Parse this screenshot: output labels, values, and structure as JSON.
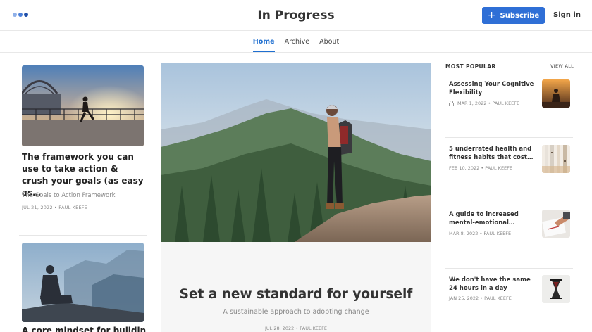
{
  "brand": {
    "accent": "#2f6fd6",
    "logo_dots": [
      "#8fb0e8",
      "#4b7fd8",
      "#1f4fa8"
    ]
  },
  "header": {
    "site_title": "In Progress",
    "subscribe_label": "Subscribe",
    "signin_label": "Sign in"
  },
  "nav": {
    "items": [
      {
        "label": "Home",
        "active": true
      },
      {
        "label": "Archive"
      },
      {
        "label": "About"
      }
    ]
  },
  "left_column": {
    "cards": [
      {
        "title": "The framework you can use to take action & crush your goals (as easy as…",
        "subtitle": "The Goals to Action Framework",
        "meta": "JUL 21, 2022 • PAUL KEEFE",
        "image": "runner-on-bridge-at-sunset"
      },
      {
        "title": "A core mindset for building",
        "image": "man-sitting-on-cliff-in-mist"
      }
    ]
  },
  "featured": {
    "title": "Set a new standard for yourself",
    "subtitle": "A sustainable approach to adopting change",
    "meta": "JUL 28, 2022 • PAUL KEEFE",
    "image": "hiker-on-mountain-overlook"
  },
  "most_popular": {
    "heading": "MOST POPULAR",
    "view_all": "VIEW ALL",
    "items": [
      {
        "title": "Assessing Your Cognitive Flexibility",
        "meta": "MAR 1, 2022 • PAUL KEEFE",
        "locked": true,
        "thumb": "person-silhouette-sunset"
      },
      {
        "title": "5 underrated health and fitness habits that cost…",
        "meta": "FEB 10, 2022 • PAUL KEEFE",
        "thumb": "birch-trees"
      },
      {
        "title": "A guide to increased mental-emotional…",
        "meta": "MAR 8, 2022 • PAUL KEEFE",
        "thumb": "hand-writing-journal"
      },
      {
        "title": "We don't have the same 24 hours in a day",
        "meta": "JAN 25, 2022 • PAUL KEEFE",
        "thumb": "hourglass"
      }
    ]
  }
}
